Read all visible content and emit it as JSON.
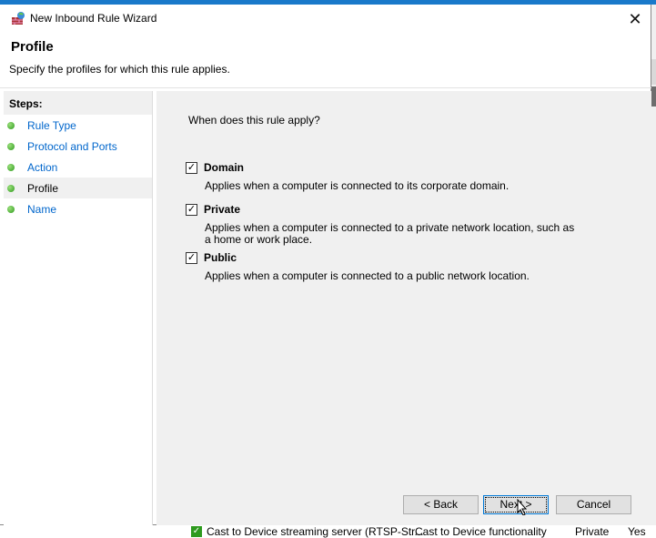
{
  "window": {
    "title": "New Inbound Rule Wizard",
    "close_icon": "close-icon"
  },
  "header": {
    "title": "Profile",
    "subtitle": "Specify the profiles for which this rule applies."
  },
  "steps": {
    "heading": "Steps:",
    "items": [
      {
        "label": "Rule Type"
      },
      {
        "label": "Protocol and Ports"
      },
      {
        "label": "Action"
      },
      {
        "label": "Profile",
        "selected": true
      },
      {
        "label": "Name"
      }
    ]
  },
  "main": {
    "question": "When does this rule apply?",
    "options": [
      {
        "label": "Domain",
        "checked": true,
        "description": "Applies when a computer is connected to its corporate domain."
      },
      {
        "label": "Private",
        "checked": true,
        "description": "Applies when a computer is connected to a private network location, such as a home or work place."
      },
      {
        "label": "Public",
        "checked": true,
        "description": "Applies when a computer is connected to a public network location."
      }
    ]
  },
  "buttons": {
    "back": "< Back",
    "next": "Next >",
    "cancel": "Cancel"
  },
  "background": {
    "row": [
      "Cast to Device streaming server (RTSP-Str...",
      "Cast to Device functionality",
      "Private",
      "Yes"
    ]
  }
}
